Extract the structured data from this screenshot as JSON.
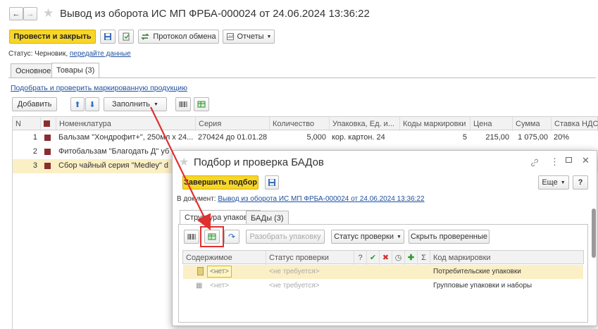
{
  "header": {
    "back": "←",
    "forward": "→",
    "star": "★",
    "title": "Вывод из оборота ИС МП ФРБА-000024 от 24.06.2024 13:36:22"
  },
  "toolbar": {
    "post_close": "Провести и закрыть",
    "protocol": "Протокол обмена",
    "reports": "Отчеты"
  },
  "status": {
    "label": "Статус: Черновик,",
    "link": "передайте данные"
  },
  "tabs": [
    {
      "label": "Основное"
    },
    {
      "label": "Товары (3)"
    }
  ],
  "goods": {
    "pick_link": "Подобрать и проверить маркированную продукцию",
    "add": "Добавить",
    "fill": "Заполнить",
    "columns": [
      "N",
      "Номенклатура",
      "Серия",
      "Количество",
      "Упаковка, Ед. и...",
      "Коды маркировки",
      "Цена",
      "Сумма",
      "Ставка НДС"
    ],
    "rows": [
      {
        "n": "1",
        "name": "Бальзам \"Хондрофит+\", 250мл х 24...",
        "series": "270424 до 01.01.28",
        "qty": "5,000",
        "pack": "кор. картон. 24",
        "codes": "5",
        "price": "215,00",
        "sum": "1 075,00",
        "vat": "20%"
      },
      {
        "n": "2",
        "name": "Фитобальзам \"Благодать Д\" уб",
        "series": "",
        "qty": "",
        "pack": "",
        "codes": "",
        "price": "",
        "sum": "",
        "vat": ""
      },
      {
        "n": "3",
        "name": "Сбор чайный серия \"Medley\" d",
        "series": "",
        "qty": "",
        "pack": "",
        "codes": "",
        "price": "",
        "sum": "",
        "vat": ""
      }
    ]
  },
  "dialog": {
    "title": "Подбор и проверка БАДов",
    "finish": "Завершить подбор",
    "more": "Еще",
    "help": "?",
    "doc_label": "В документ:",
    "doc_link": "Вывод из оборота ИС МП ФРБА-000024 от 24.06.2024 13:36:22",
    "tabs": [
      {
        "label": "Структура упаковок"
      },
      {
        "label": "БАДы (3)"
      }
    ],
    "unpack": "Разобрать упаковку",
    "check_status": "Статус проверки",
    "hide_checked": "Скрыть проверенные",
    "columns": {
      "content": "Содержимое",
      "status": "Статус проверки",
      "q": "?",
      "sigma": "Σ",
      "code": "Код маркировки"
    },
    "rows": [
      {
        "content": "<нет>",
        "status": "<не требуется>",
        "code": "Потребительские упаковки"
      },
      {
        "content": "<нет>",
        "status": "<не требуется>",
        "code": "Групповые упаковки и наборы"
      }
    ]
  },
  "colors": {
    "accent_yellow": "#f8d628",
    "link": "#1e4f9e",
    "highlight_row": "#fbefc6",
    "arrow": "#e03030"
  }
}
